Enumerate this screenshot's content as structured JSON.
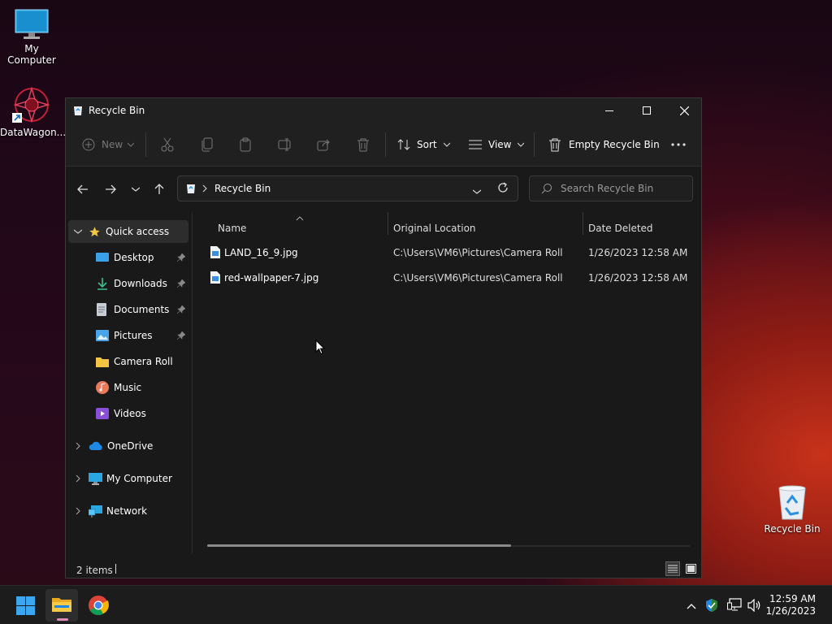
{
  "desktop": {
    "icons": [
      {
        "label": "My Computer"
      },
      {
        "label": "DataWagon..."
      },
      {
        "label": "Recycle Bin"
      }
    ]
  },
  "window": {
    "title": "Recycle Bin",
    "toolbar": {
      "new_label": "New",
      "sort_label": "Sort",
      "view_label": "View",
      "empty_label": "Empty Recycle Bin"
    },
    "address": {
      "path": "Recycle Bin"
    },
    "search": {
      "placeholder": "Search Recycle Bin"
    },
    "sidebar": {
      "quick_access": "Quick access",
      "items": [
        {
          "label": "Desktop"
        },
        {
          "label": "Downloads"
        },
        {
          "label": "Documents"
        },
        {
          "label": "Pictures"
        },
        {
          "label": "Camera Roll"
        },
        {
          "label": "Music"
        },
        {
          "label": "Videos"
        }
      ],
      "onedrive": "OneDrive",
      "my_computer": "My Computer",
      "network": "Network"
    },
    "columns": {
      "name": "Name",
      "location": "Original Location",
      "date": "Date Deleted"
    },
    "files": [
      {
        "name": "LAND_16_9.jpg",
        "location": "C:\\Users\\VM6\\Pictures\\Camera Roll",
        "date": "1/26/2023 12:58 AM"
      },
      {
        "name": "red-wallpaper-7.jpg",
        "location": "C:\\Users\\VM6\\Pictures\\Camera Roll",
        "date": "1/26/2023 12:58 AM"
      }
    ],
    "status": {
      "count": "2 items"
    }
  },
  "taskbar": {
    "time": "12:59 AM",
    "date": "1/26/2023"
  },
  "colors": {
    "accent": "#0078d4",
    "folder": "#f4c542",
    "window_bg": "#191919"
  }
}
